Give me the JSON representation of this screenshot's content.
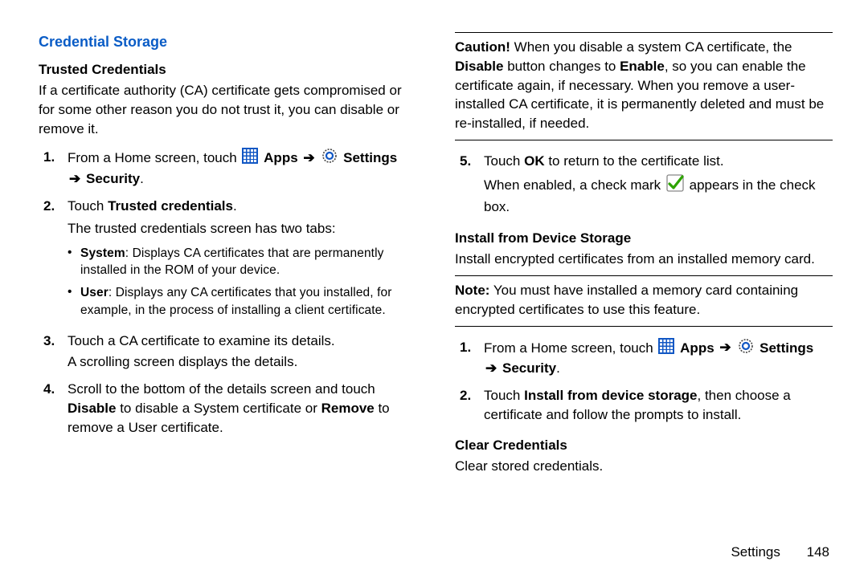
{
  "section_title": "Credential Storage",
  "left": {
    "sub1": "Trusted Credentials",
    "intro": "If a certificate authority (CA) certificate gets compromised or for some other reason you do not trust it, you can disable or remove it.",
    "step1_a": "From a Home screen, touch ",
    "apps": "Apps",
    "settings": "Settings",
    "step1_b": "Security",
    "step2_a": "Touch ",
    "step2_b": "Trusted credentials",
    "step2_c": "The trusted credentials screen has two tabs:",
    "bullet1a": "System",
    "bullet1b": ": Displays CA certificates that are permanently installed in the ROM of your device.",
    "bullet2a": "User",
    "bullet2b": ": Displays any CA certificates that you installed, for example, in the process of installing a client certificate.",
    "step3a": "Touch a CA certificate to examine its details.",
    "step3b": "A scrolling screen displays the details.",
    "step4a": "Scroll to the bottom of the details screen and touch ",
    "step4b": "Disable",
    "step4c": " to disable a System certificate or ",
    "step4d": "Remove",
    "step4e": " to remove a User certificate."
  },
  "right": {
    "caution_label": "Caution!",
    "caution_a": " When you disable a system CA certificate, the ",
    "caution_b": "Disable",
    "caution_c": " button changes to ",
    "caution_d": "Enable",
    "caution_e": ", so you can enable the certificate again, if necessary. When you remove a user-installed CA certificate, it is permanently deleted and must be re-installed, if needed.",
    "step5a": "Touch ",
    "step5b": "OK",
    "step5c": " to return to the certificate list.",
    "step5d": "When enabled, a check mark ",
    "step5e": " appears in the check box.",
    "sub2": "Install from Device Storage",
    "install_intro": "Install encrypted certificates from an installed memory card.",
    "note_label": "Note:",
    "note_text": " You must have installed a memory card containing encrypted certificates to use this feature.",
    "r_step1_a": "From a Home screen, touch ",
    "r_step1_apps": "Apps",
    "r_step1_sett": "Settings",
    "r_step1_b": "Security",
    "r_step2a": "Touch ",
    "r_step2b": "Install from device storage",
    "r_step2c": ", then choose a certificate and follow the prompts to install.",
    "sub3": "Clear Credentials",
    "clear_text": "Clear stored credentials."
  },
  "footer": {
    "section": "Settings",
    "page": "148"
  },
  "arrow": "➔"
}
